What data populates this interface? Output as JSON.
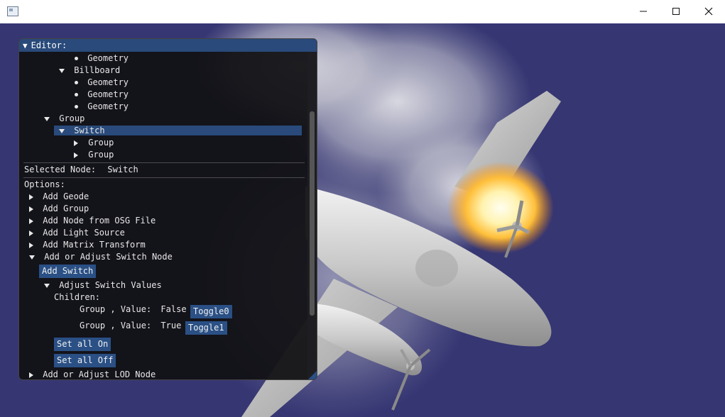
{
  "window": {
    "controls": {
      "minimize": "minimize",
      "maximize": "maximize",
      "close": "close"
    }
  },
  "editor": {
    "title": "Editor:",
    "tree": [
      {
        "label": "Geometry",
        "marker": "bullet"
      },
      {
        "label": "Billboard",
        "marker": "open"
      },
      {
        "label": "Geometry",
        "marker": "bullet"
      },
      {
        "label": "Geometry",
        "marker": "bullet"
      },
      {
        "label": "Geometry",
        "marker": "bullet"
      },
      {
        "label": "Group",
        "marker": "open"
      },
      {
        "label": "Switch",
        "marker": "open",
        "selected": true
      },
      {
        "label": "Group",
        "marker": "closed"
      },
      {
        "label": "Group",
        "marker": "closed"
      }
    ],
    "selected_label": "Selected Node:",
    "selected_value": "Switch",
    "options_label": "Options:",
    "options": [
      "Add Geode",
      "Add Group",
      "Add Node from OSG File",
      "Add Light Source",
      "Add Matrix Transform",
      "Add or Adjust Switch Node"
    ],
    "add_switch": "Add Switch",
    "adjust_values": "Adjust Switch Values",
    "children_label": "Children:",
    "children": [
      {
        "name": "Group",
        "sep": ",",
        "value_label": "Value:",
        "value": "False",
        "toggle": "Toggle0"
      },
      {
        "name": "Group",
        "sep": ",",
        "value_label": "Value:",
        "value": "True",
        "toggle": "Toggle1"
      }
    ],
    "set_all_on": "Set all On",
    "set_all_off": "Set all Off",
    "lod_option": "Add or Adjust LOD Node"
  },
  "colors": {
    "sky": "#363673",
    "title_bar": "#294a7a",
    "button": "#2a5085",
    "panel_bg": "#111114"
  }
}
